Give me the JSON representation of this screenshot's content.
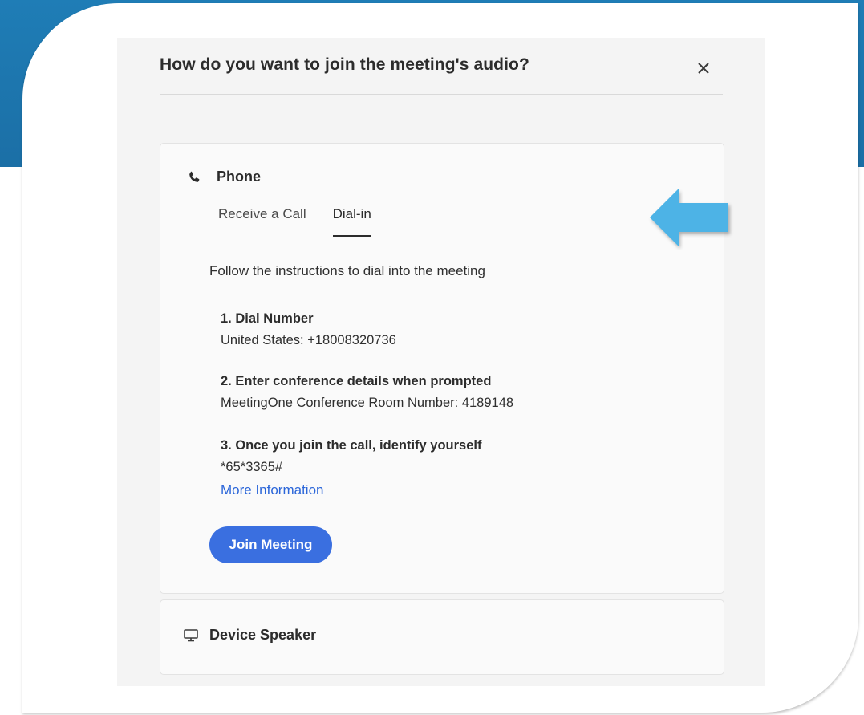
{
  "dialog": {
    "title": "How do you want to join the meeting's audio?",
    "close_label": "×"
  },
  "phone": {
    "label": "Phone",
    "tabs": [
      {
        "label": "Receive a Call",
        "active": false
      },
      {
        "label": "Dial-in",
        "active": true
      }
    ],
    "instructions": "Follow the instructions to dial into the meeting",
    "steps": [
      {
        "title": "1. Dial Number",
        "detail": "United States: +18008320736"
      },
      {
        "title": "2. Enter conference details when prompted",
        "detail": "MeetingOne Conference Room Number: 4189148"
      },
      {
        "title": "3. Once you join the call, identify yourself",
        "detail": "*65*3365#"
      }
    ],
    "more_info_label": "More Information",
    "join_button_label": "Join Meeting"
  },
  "device_speaker": {
    "label": "Device Speaker"
  },
  "colors": {
    "accent": "#3a6fe0",
    "link": "#2b66d9",
    "backdrop": "#1f7db6",
    "arrow": "#4db3e6"
  },
  "icons": {
    "phone": "phone-icon",
    "monitor": "monitor-icon",
    "close": "close-icon",
    "annotation": "arrow-left-icon"
  }
}
